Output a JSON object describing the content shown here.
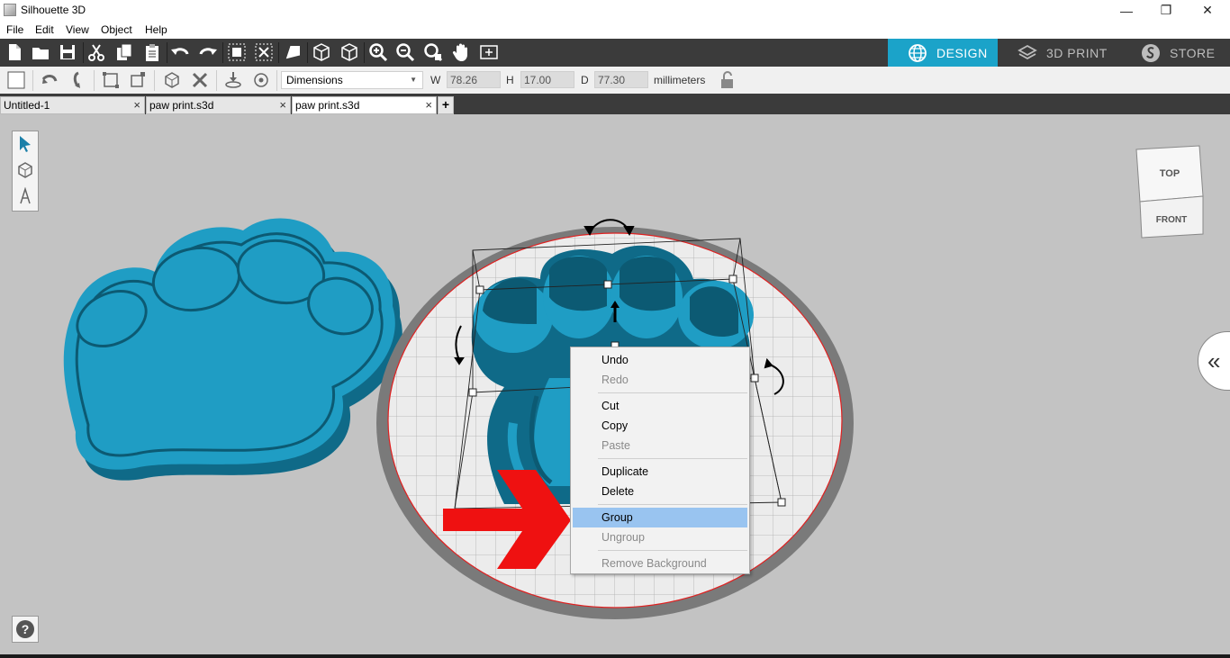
{
  "window": {
    "title": "Silhouette 3D",
    "controls": {
      "minimize": "—",
      "restore": "❐",
      "close": "✕"
    }
  },
  "menubar": {
    "items": [
      "File",
      "Edit",
      "View",
      "Object",
      "Help"
    ]
  },
  "toolbar": {
    "icons": [
      "new-file-icon",
      "open-folder-icon",
      "save-icon",
      "cut-icon",
      "copy-icon",
      "paste-icon",
      "undo-icon",
      "redo-icon",
      "group-icon",
      "ungroup-icon",
      "perspective-icon",
      "view-cube-icon",
      "view-iso-icon",
      "zoom-in-icon",
      "zoom-out-icon",
      "zoom-fit-icon",
      "pan-hand-icon",
      "fit-page-icon"
    ]
  },
  "mode_tabs": {
    "design": "DESIGN",
    "print": "3D PRINT",
    "store": "STORE",
    "active": "design",
    "active_color": "#1ba3c9"
  },
  "toolbar2": {
    "dimensions_mode": "Dimensions",
    "w_label": "W",
    "w_value": "78.26",
    "h_label": "H",
    "h_value": "17.00",
    "d_label": "D",
    "d_value": "77.30",
    "units": "millimeters"
  },
  "tabs": [
    {
      "label": "Untitled-1",
      "close": "×"
    },
    {
      "label": "paw print.s3d",
      "close": "×"
    },
    {
      "label": "paw print.s3d",
      "close": "×",
      "active": true
    }
  ],
  "new_tab": "+",
  "viewcube": {
    "top": "TOP",
    "front": "FRONT"
  },
  "panel_toggle": "«",
  "help": "?",
  "context_menu": {
    "items": [
      {
        "label": "Undo",
        "enabled": true
      },
      {
        "label": "Redo",
        "enabled": false
      },
      {
        "label": "Cut",
        "enabled": true
      },
      {
        "label": "Copy",
        "enabled": true
      },
      {
        "label": "Paste",
        "enabled": false
      },
      {
        "label": "Duplicate",
        "enabled": true
      },
      {
        "label": "Delete",
        "enabled": true
      },
      {
        "label": "Group",
        "enabled": true,
        "highlighted": true
      },
      {
        "label": "Ungroup",
        "enabled": false
      },
      {
        "label": "Remove Background",
        "enabled": false
      }
    ]
  },
  "colors": {
    "model": "#1f9dc4",
    "model_dark": "#0f6a88",
    "highlight": "#99c4f0",
    "arrow": "#ef1111"
  }
}
